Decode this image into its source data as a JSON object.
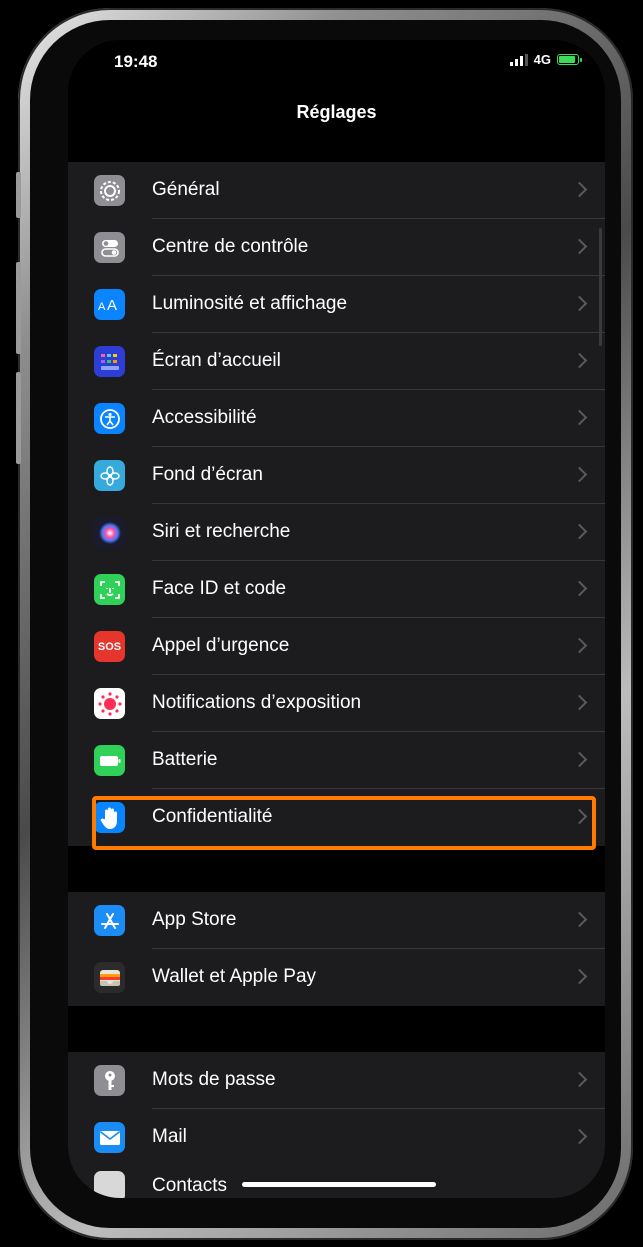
{
  "status_bar": {
    "time": "19:48",
    "network": "4G"
  },
  "nav": {
    "title": "Réglages"
  },
  "groups": [
    {
      "items": [
        {
          "label": "Général",
          "icon": "gear-icon",
          "color": "#8e8e93"
        },
        {
          "label": "Centre de contrôle",
          "icon": "toggles-icon",
          "color": "#8e8e93"
        },
        {
          "label": "Luminosité et affichage",
          "icon": "text-size-icon",
          "color": "#0a84ff"
        },
        {
          "label": "Écran d’accueil",
          "icon": "home-grid-icon",
          "color": "#2c3ed6"
        },
        {
          "label": "Accessibilité",
          "icon": "accessibility-icon",
          "color": "#0a84ff"
        },
        {
          "label": "Fond d’écran",
          "icon": "flower-icon",
          "color": "#36aadc"
        },
        {
          "label": "Siri et recherche",
          "icon": "siri-icon",
          "color": "#1b1b2e"
        },
        {
          "label": "Face ID et code",
          "icon": "face-id-icon",
          "color": "#30d158"
        },
        {
          "label": "Appel d’urgence",
          "icon": "sos-icon",
          "color": "#e5352d",
          "icon_text": "SOS"
        },
        {
          "label": "Notifications d’exposition",
          "icon": "exposure-icon",
          "color": "#ffffff"
        },
        {
          "label": "Batterie",
          "icon": "battery-settings-icon",
          "color": "#30d158"
        },
        {
          "label": "Confidentialité",
          "icon": "hand-icon",
          "color": "#0a84ff"
        }
      ]
    },
    {
      "items": [
        {
          "label": "App Store",
          "icon": "app-store-icon",
          "color": "#1c8cf7"
        },
        {
          "label": "Wallet et Apple Pay",
          "icon": "wallet-icon",
          "color": "#2b2b2b"
        }
      ]
    },
    {
      "items": [
        {
          "label": "Mots de passe",
          "icon": "key-icon",
          "color": "#8e8e93"
        },
        {
          "label": "Mail",
          "icon": "mail-icon",
          "color": "#1a8cf5"
        }
      ]
    }
  ],
  "partial_item": {
    "label": "Contacts"
  },
  "colors": {
    "highlight": "#ff7a00",
    "background": "#000000",
    "cell": "#1c1c1e"
  }
}
